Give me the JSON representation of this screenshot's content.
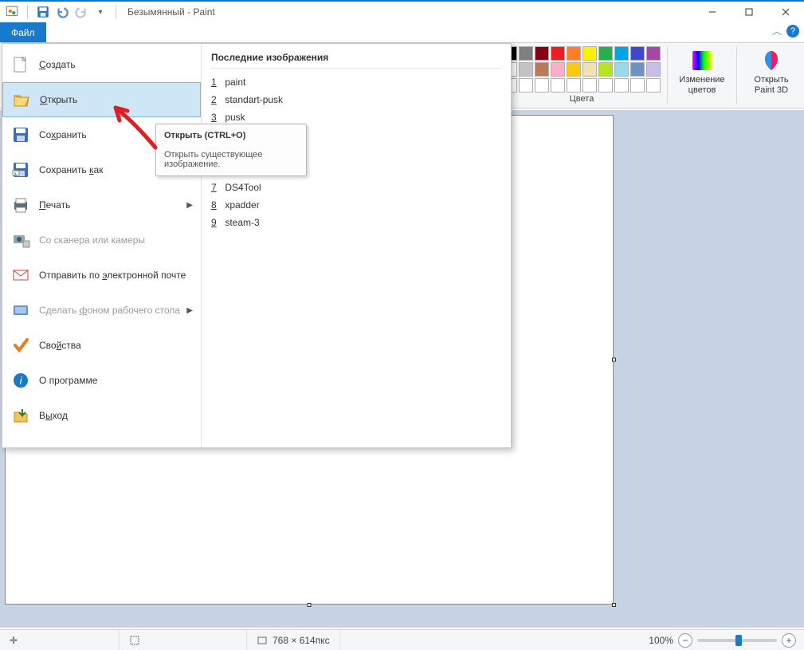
{
  "title": "Безымянный - Paint",
  "filetab": "Файл",
  "ribbon": {
    "colors_label": "Цвета",
    "edit_colors": "Изменение цветов",
    "open_paint3d_l1": "Открыть",
    "open_paint3d_l2": "Paint 3D",
    "palette_row1": [
      "#000000",
      "#7f7f7f",
      "#880015",
      "#ed1c24",
      "#ff7f27",
      "#fff200",
      "#22b14c",
      "#00a2e8",
      "#3f48cc",
      "#a349a4"
    ],
    "palette_row2": [
      "#ffffff",
      "#c3c3c3",
      "#b97a57",
      "#ffaec9",
      "#ffc90e",
      "#efe4b0",
      "#b5e61d",
      "#99d9ea",
      "#7092be",
      "#c8bfe7"
    ],
    "palette_row3": [
      "#ffffff",
      "#ffffff",
      "#ffffff",
      "#ffffff",
      "#ffffff",
      "#ffffff",
      "#ffffff",
      "#ffffff",
      "#ffffff",
      "#ffffff"
    ]
  },
  "filemenu": {
    "items": [
      {
        "label": "Создать",
        "u": "С",
        "rest": "оздать"
      },
      {
        "label": "Открыть",
        "u": "О",
        "rest": "ткрыть"
      },
      {
        "label": "Сохранить",
        "u": "х",
        "pre": "Со",
        "rest": "ранить"
      },
      {
        "label": "Сохранить как",
        "u": "к",
        "pre": "Сохранить ",
        "rest": "ак",
        "arrow": true
      },
      {
        "label": "Печать",
        "u": "П",
        "rest": "ечать",
        "arrow": true
      },
      {
        "label": "Со сканера или камеры",
        "disabled": true
      },
      {
        "label": "Отправить по электронной почте",
        "u": "э",
        "pre": "Отправить по ",
        "rest": "лектронной почте"
      },
      {
        "label": "Сделать фоном рабочего стола",
        "u": "ф",
        "pre": "Сделать ",
        "rest": "оном рабочего стола",
        "arrow": true,
        "disabled": true
      },
      {
        "label": "Свойства",
        "u": "й",
        "pre": "Сво",
        "rest": "ства"
      },
      {
        "label": "О программе"
      },
      {
        "label": "Выход",
        "u": "ы",
        "pre": "В",
        "rest": "ход"
      }
    ],
    "recent_title": "Последние изображения",
    "recent": [
      "paint",
      "standart-pusk",
      "pusk",
      "",
      "",
      "",
      "DS4Tool",
      "xpadder",
      "steam-3"
    ],
    "recent_nums": [
      "1",
      "2",
      "3",
      "",
      "",
      "",
      "7",
      "8",
      "9"
    ]
  },
  "tooltip": {
    "title": "Открыть (CTRL+O)",
    "body": "Открыть существующее изображение."
  },
  "status": {
    "size": "768 × 614пкс",
    "zoom": "100%"
  }
}
